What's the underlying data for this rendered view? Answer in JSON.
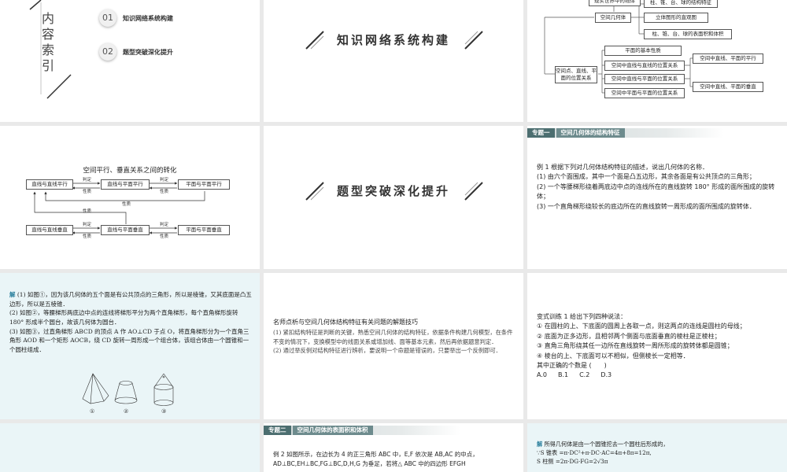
{
  "toc": {
    "vertical_title": [
      "内",
      "容",
      "索",
      "引"
    ],
    "items": [
      {
        "num": "01",
        "label": "知识网络系统构建"
      },
      {
        "num": "02",
        "label": "题型突破深化提升"
      }
    ]
  },
  "section1": {
    "title": "知识网络系统构建"
  },
  "section2": {
    "title": "题型突破深化提升"
  },
  "mindmap": {
    "top_partial": "现实世界中的物体",
    "center": "空间几何体",
    "branch1": [
      "柱、锥、台、球的结构特征",
      "立体图形的直观图",
      "柱、锥、台、球的表面积和体积"
    ],
    "center2": "空间点、直线、平面的位置关系",
    "branch2": [
      "平面的基本性质",
      "空间中直线与直线的位置关系",
      "空间中直线与平面的位置关系",
      "空间中平面与平面的位置关系"
    ],
    "right": [
      "空间中直线、平面的平行",
      "空间中直线、平面的垂直"
    ]
  },
  "transform": {
    "title": "空间平行、垂直关系之间的转化",
    "row1": [
      "直线与直线平行",
      "直线与平面平行",
      "平面与平面平行"
    ],
    "row2": [
      "直线与直线垂直",
      "直线与平面垂直",
      "平面与平面垂直"
    ],
    "labels": {
      "judge": "判定",
      "prop": "性质"
    }
  },
  "topic1": {
    "tag": "专题一",
    "title": "空间几何体的结构特征",
    "example": "例 1 根据下列对几何体结构特征的描述，说出几何体的名称．",
    "items": [
      "(1) 由六个面围成，其中一个面是凸五边形，其余各面是有公共顶点的三角形；",
      "(2) 一个等腰梯形绕着两底边中点的连线所在的直线旋转 180° 形成的面所围成的旋转体；",
      "(3) 一个直角梯形绕较长的底边所在的直线旋转一周形成的面所围成的旋转体．"
    ]
  },
  "solution1": {
    "prefix": "解",
    "lines": [
      " (1) 如图①，因为该几何体的五个面是有公共顶点的三角形，所以是棱锥，又其底面是凸五边形，所以是五棱锥．",
      "(2) 如图②，等腰梯形两底边中点的连线将梯形平分为两个直角梯形，每个直角梯形旋转 180° 形成半个圆台，故该几何体为圆台．",
      "(3) 如图③，过直角梯形 ABCD 的顶点 A 作 AO⊥CD 于点 O，将直角梯形分为一个直角三角形 AOD 和一个矩形 AOCB，绕 CD 旋转一周形成一个组合体，该组合体由一个圆锥和一个圆柱组成．"
    ],
    "fig_labels": [
      "①",
      "②",
      "③"
    ]
  },
  "method": {
    "title": "名师点析与空间几何体结构特征有关问题的解题技巧",
    "lines": [
      "(1) 紧扣结构特征是判断的关键，熟悉空间几何体的结构特征，依据条件构建几何模型，在条件不变的情况下，变换模型中的线面关系或增加线、面等基本元素，然后再依据题意判定．",
      "(2) 通过举反例对结构特征进行辨析，要说明一个命题是错误的，只要举出一个反例即可．"
    ]
  },
  "exercise": {
    "title": "变式训练 1 给出下列四种说法：",
    "items": [
      "① 在圆柱的上、下底面的圆周上各取一点，则这两点的连线是圆柱的母线；",
      "② 底面为正多边形，且相邻两个侧面与底面垂直的棱柱是正棱柱；",
      "③ 直角三角形绕其任一边所在直线旋转一周所形成的旋转体都是圆锥；",
      "④ 棱台的上、下底面可以不相似，但侧棱长一定相等．"
    ],
    "question": "其中正确的个数是 (　　)",
    "options": [
      "A.0",
      "B.1",
      "C.2",
      "D.3"
    ]
  },
  "topic2": {
    "tag": "专题二",
    "title": "空间几何体的表面积和体积",
    "lines": [
      "例 2 如图所示，在边长为 4 的正三角形 ABC 中，E,F 依次是 AB,AC 的中点，",
      "AD⊥BC,EH⊥BC,FG⊥BC,D,H,G 为垂足，若将△ ABC 中的四边形 EFGH"
    ]
  },
  "solution2": {
    "prefix": "解",
    "lines": [
      " 所得几何体是由一个圆锥挖去一个圆柱后形成的，",
      "∵S 锥表 =π·DC²+π·DC·AC=4π+8π=12π,",
      "S 柱侧 =2π·DG·FG=2√3π"
    ]
  }
}
